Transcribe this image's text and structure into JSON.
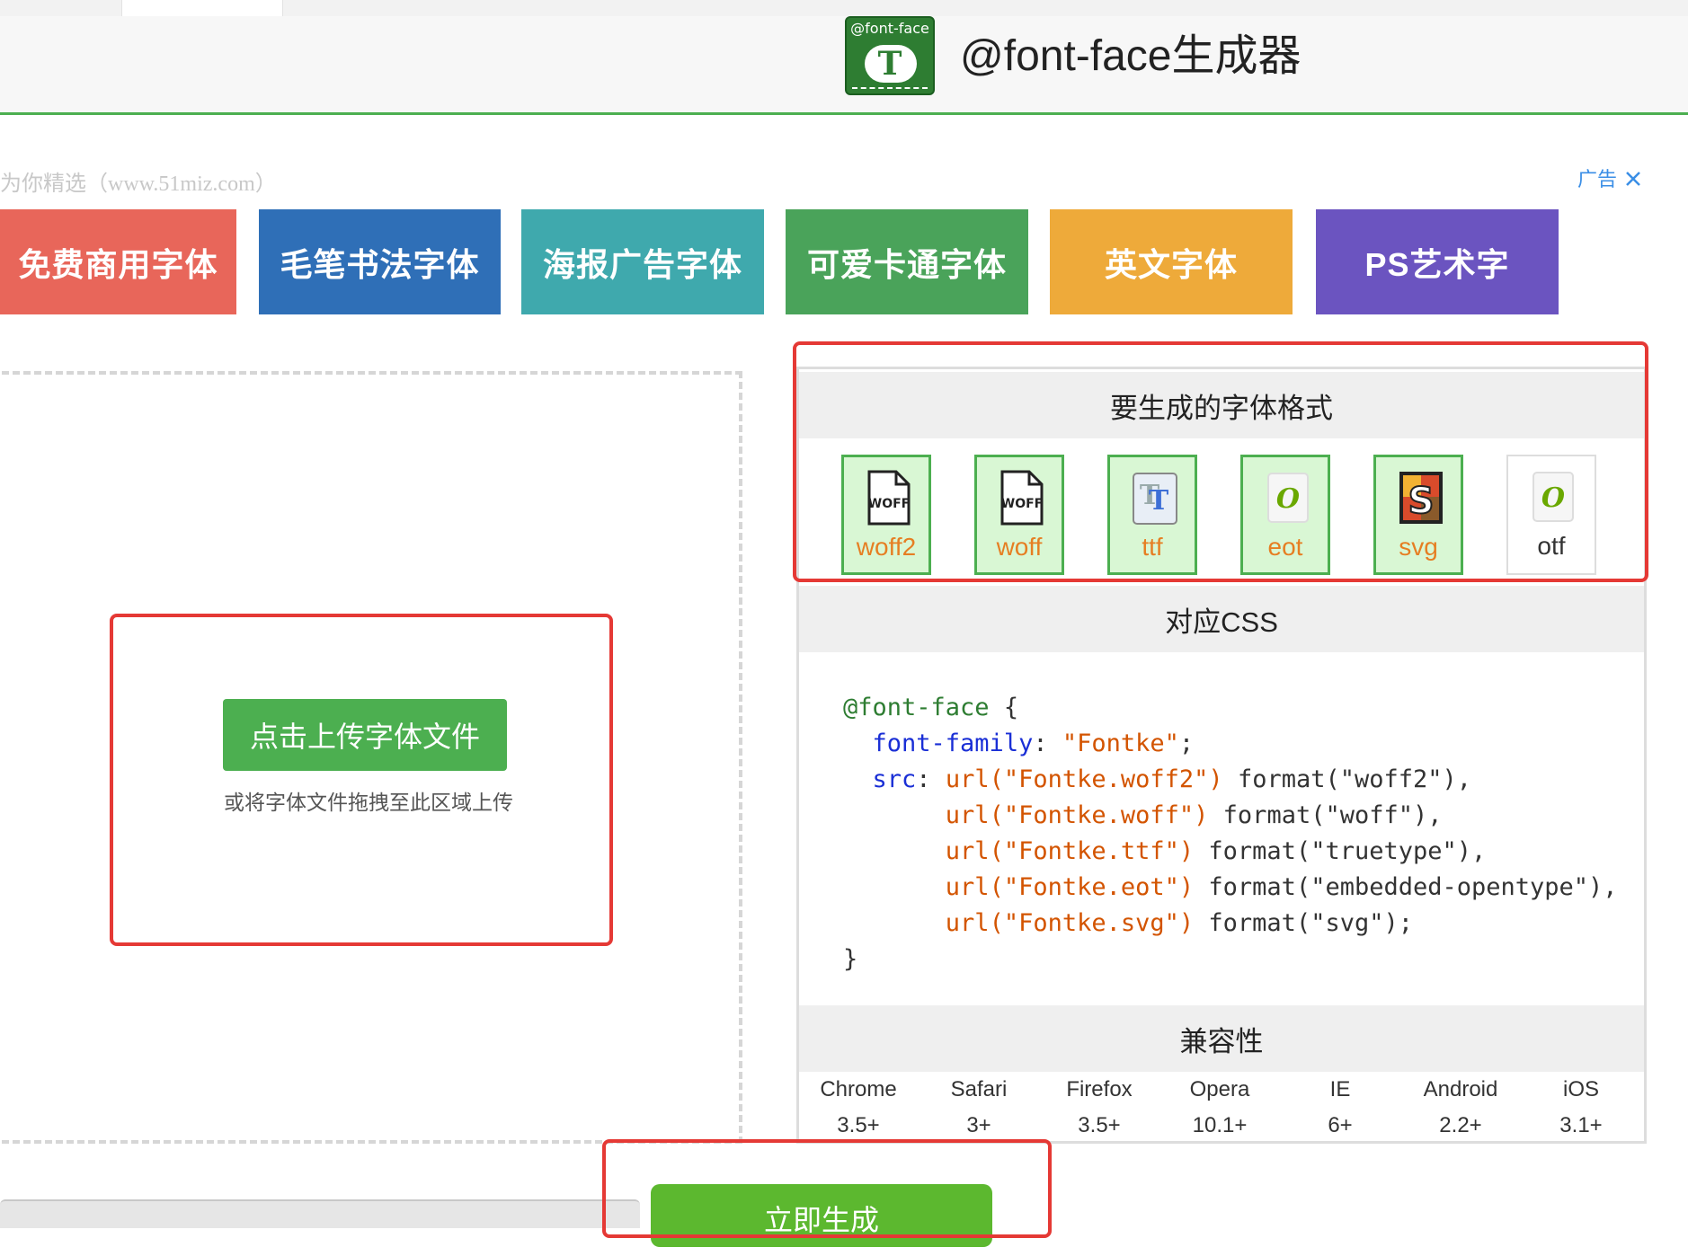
{
  "header": {
    "logo_text": "@font-face",
    "logo_letter": "T",
    "title": "@font-face生成器"
  },
  "ads": {
    "label": "为你精选（www.51miz.com）",
    "ad_text": "广告",
    "close_icon": "close-icon",
    "tiles": [
      {
        "label": "免费商用字体",
        "color": "#e8665a"
      },
      {
        "label": "毛笔书法字体",
        "color": "#2f6fb7"
      },
      {
        "label": "海报广告字体",
        "color": "#3fa9ad"
      },
      {
        "label": "可爱卡通字体",
        "color": "#4aa35a"
      },
      {
        "label": "英文字体",
        "color": "#eeaa3a"
      },
      {
        "label": "PS艺术字",
        "color": "#6b54c0"
      }
    ]
  },
  "upload": {
    "button": "点击上传字体文件",
    "hint": "或将字体文件拖拽至此区域上传"
  },
  "formats": {
    "title": "要生成的字体格式",
    "items": [
      {
        "label": "woff2",
        "icon": "woff-file-icon",
        "selected": true
      },
      {
        "label": "woff",
        "icon": "woff-file-icon",
        "selected": true
      },
      {
        "label": "ttf",
        "icon": "truetype-icon",
        "selected": true
      },
      {
        "label": "eot",
        "icon": "opentype-icon",
        "selected": true
      },
      {
        "label": "svg",
        "icon": "svg-icon",
        "selected": true
      },
      {
        "label": "otf",
        "icon": "opentype-icon",
        "selected": false
      }
    ]
  },
  "css": {
    "title": "对应CSS",
    "rule": "@font-face",
    "open_brace": "{",
    "close_brace": "}",
    "family_prop": "font-family",
    "family_value": "\"Fontke\"",
    "src_prop": "src",
    "sources": [
      {
        "url": "url(\"Fontke.woff2\")",
        "format": "format(\"woff2\"),"
      },
      {
        "url": "url(\"Fontke.woff\")",
        "format": "format(\"woff\"),"
      },
      {
        "url": "url(\"Fontke.ttf\")",
        "format": "format(\"truetype\"),"
      },
      {
        "url": "url(\"Fontke.eot\")",
        "format": "format(\"embedded-opentype\"),"
      },
      {
        "url": "url(\"Fontke.svg\")",
        "format": "format(\"svg\");"
      }
    ]
  },
  "compat": {
    "title": "兼容性",
    "browsers": [
      {
        "name": "Chrome",
        "version": "3.5+"
      },
      {
        "name": "Safari",
        "version": "3+"
      },
      {
        "name": "Firefox",
        "version": "3.5+"
      },
      {
        "name": "Opera",
        "version": "10.1+"
      },
      {
        "name": "IE",
        "version": "6+"
      },
      {
        "name": "Android",
        "version": "2.2+"
      },
      {
        "name": "iOS",
        "version": "3.1+"
      }
    ]
  },
  "generate_button": "立即生成",
  "colors": {
    "accent_green": "#4caf50",
    "highlight_red": "#e53935",
    "format_selected_bg": "#d9f7d4"
  }
}
